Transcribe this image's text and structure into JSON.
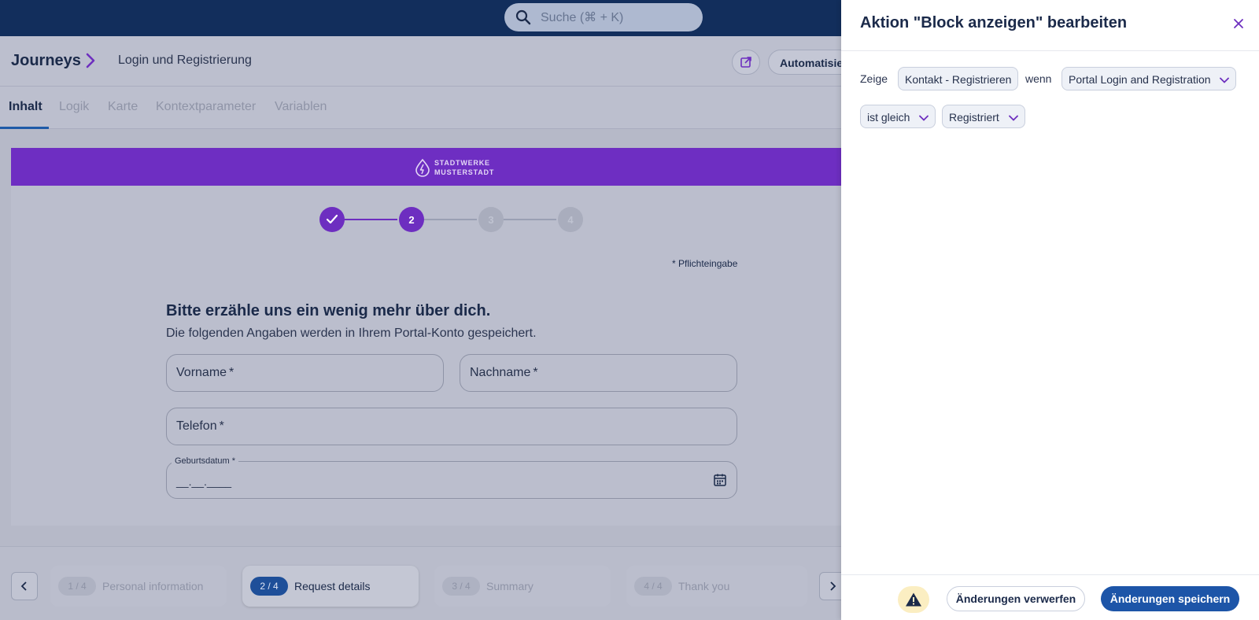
{
  "search": {
    "placeholder": "Suche (⌘ + K)",
    "icon": "search-icon"
  },
  "header": {
    "breadcrumb_root": "Journeys",
    "breadcrumb_page": "Login und Registrierung",
    "automation_label": "Automatisieren"
  },
  "tabs": [
    "Inhalt",
    "Logik",
    "Karte",
    "Kontextparameter",
    "Variablen"
  ],
  "active_tab": "Inhalt",
  "preview": {
    "brand_line1": "STADTWERKE",
    "brand_line2": "MUSTERSTADT",
    "brand_color": "#6e2ec2",
    "steps": [
      "✓",
      "2",
      "3",
      "4"
    ],
    "required_note": "* Pflichteingabe",
    "form_title": "Bitte erzähle uns ein wenig mehr über dich.",
    "form_subtitle": "Die folgenden Angaben werden in Ihrem Portal-Konto gespeichert.",
    "fields": {
      "first_name": "Vorname",
      "last_name": "Nachname",
      "phone": "Telefon",
      "birthdate": "Geburtsdatum",
      "birthdate_mask": "__.__.____",
      "required_marker": "*"
    }
  },
  "step_nav": [
    {
      "badge": "1 / 4",
      "label": "Personal information"
    },
    {
      "badge": "2 / 4",
      "label": "Request details"
    },
    {
      "badge": "3 / 4",
      "label": "Summary"
    },
    {
      "badge": "4 / 4",
      "label": "Thank you"
    }
  ],
  "drawer": {
    "title": "Aktion \"Block anzeigen\" bearbeiten",
    "show_word": "Zeige",
    "block_chip": "Kontakt - Registrieren",
    "when_word": "wenn",
    "source_select": "Portal Login and Registration",
    "operator_select": "ist gleich",
    "value_select": "Registriert",
    "discard_label": "Änderungen verwerfen",
    "save_label": "Änderungen speichern",
    "accent_color": "#1d55a8"
  }
}
